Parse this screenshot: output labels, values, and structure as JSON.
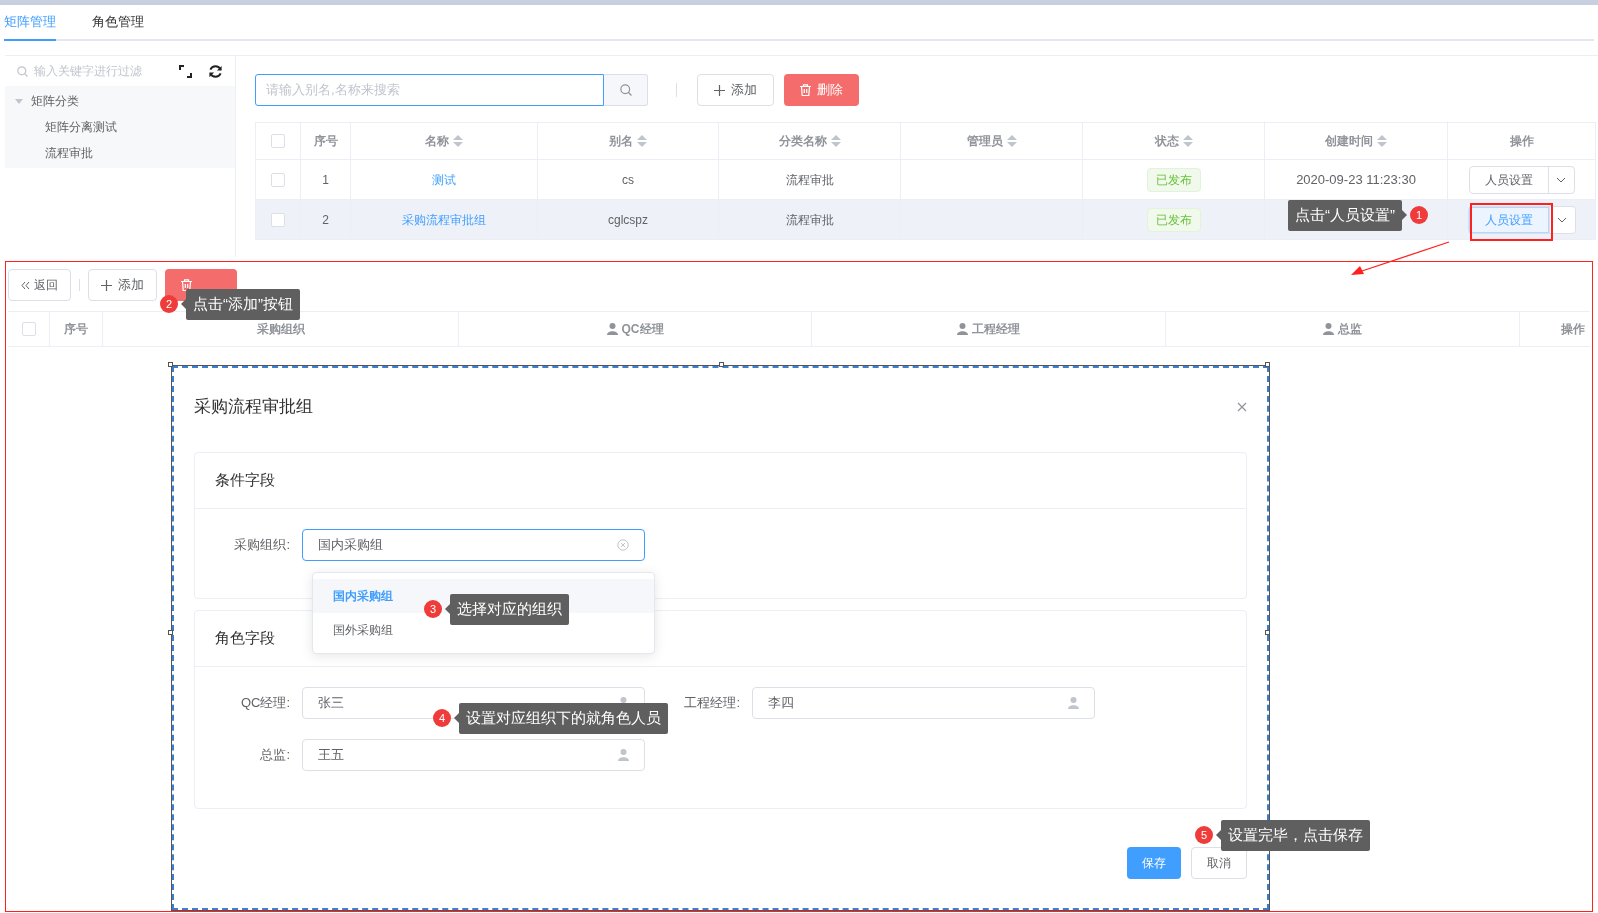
{
  "tabs": [
    {
      "label": "矩阵管理",
      "selected": true
    },
    {
      "label": "角色管理",
      "selected": false
    }
  ],
  "tree": {
    "filter_placeholder": "输入关键字进行过滤",
    "items": [
      {
        "label": "矩阵分类",
        "expanded": true,
        "children": [
          {
            "label": "矩阵分离测试"
          },
          {
            "label": "流程审批"
          }
        ]
      }
    ]
  },
  "search": {
    "placeholder": "请输入别名,名称来搜索"
  },
  "toolbar": [
    {
      "kind": "add",
      "label": "添加"
    },
    {
      "kind": "delete",
      "label": "删除"
    }
  ],
  "table": {
    "header_checked": false,
    "columns": [
      {
        "label": "序号",
        "sortable": false
      },
      {
        "label": "名称",
        "sortable": true
      },
      {
        "label": "别名",
        "sortable": true
      },
      {
        "label": "分类名称",
        "sortable": true
      },
      {
        "label": "管理员",
        "sortable": true
      },
      {
        "label": "状态",
        "sortable": true
      },
      {
        "label": "创建时间",
        "sortable": true
      },
      {
        "label": "操作",
        "sortable": false
      }
    ],
    "rows": [
      {
        "checked": false,
        "hovered": false,
        "index": "1",
        "name": "测试",
        "alias": "cs",
        "category": "流程审批",
        "status": "已发布",
        "created": "2020-09-23 11:23:30",
        "action": "人员设置",
        "action_active": false
      },
      {
        "checked": false,
        "hovered": true,
        "index": "2",
        "name": "采购流程审批组",
        "alias": "cglcspz",
        "category": "流程审批",
        "status": "已发布",
        "action": "人员设置",
        "action_active": true
      }
    ]
  },
  "detail": {
    "back": "返回",
    "toolbar": [
      {
        "kind": "add",
        "label": "添加"
      },
      {
        "kind": "delete"
      }
    ],
    "header_checked": false,
    "columns": [
      {
        "label": "序号",
        "person": false
      },
      {
        "label": "采购组织",
        "person": false
      },
      {
        "label": "QC经理",
        "person": true
      },
      {
        "label": "工程经理",
        "person": true
      },
      {
        "label": "总监",
        "person": true
      },
      {
        "label": "操作",
        "person": false
      }
    ]
  },
  "dialog": {
    "title": "采购流程审批组",
    "sections": [
      {
        "title": "条件字段",
        "fields": [
          {
            "kind": "select",
            "label": "采购组织:",
            "value": "国内采购组"
          }
        ]
      },
      {
        "title": "角色字段",
        "fields": [
          {
            "kind": "person",
            "label": "QC经理:",
            "value": "张三"
          },
          {
            "kind": "person",
            "label": "工程经理:",
            "value": "李四"
          },
          {
            "kind": "person",
            "label": "总监:",
            "value": "王五"
          }
        ]
      }
    ],
    "options": [
      {
        "label": "国内采购组",
        "selected": true
      },
      {
        "label": "国外采购组",
        "selected": false
      }
    ],
    "buttons": [
      {
        "kind": "primary",
        "label": "保存"
      },
      {
        "kind": "default",
        "label": "取消"
      }
    ]
  },
  "annotations": [
    {
      "number": "1",
      "text": "点击“人员设置”"
    },
    {
      "number": "2",
      "text": "点击“添加”按钮"
    },
    {
      "number": "3",
      "text": "选择对应的组织"
    },
    {
      "number": "4",
      "text": "设置对应组织下的就角色人员"
    },
    {
      "number": "5",
      "text": "设置完毕，点击保存"
    }
  ]
}
